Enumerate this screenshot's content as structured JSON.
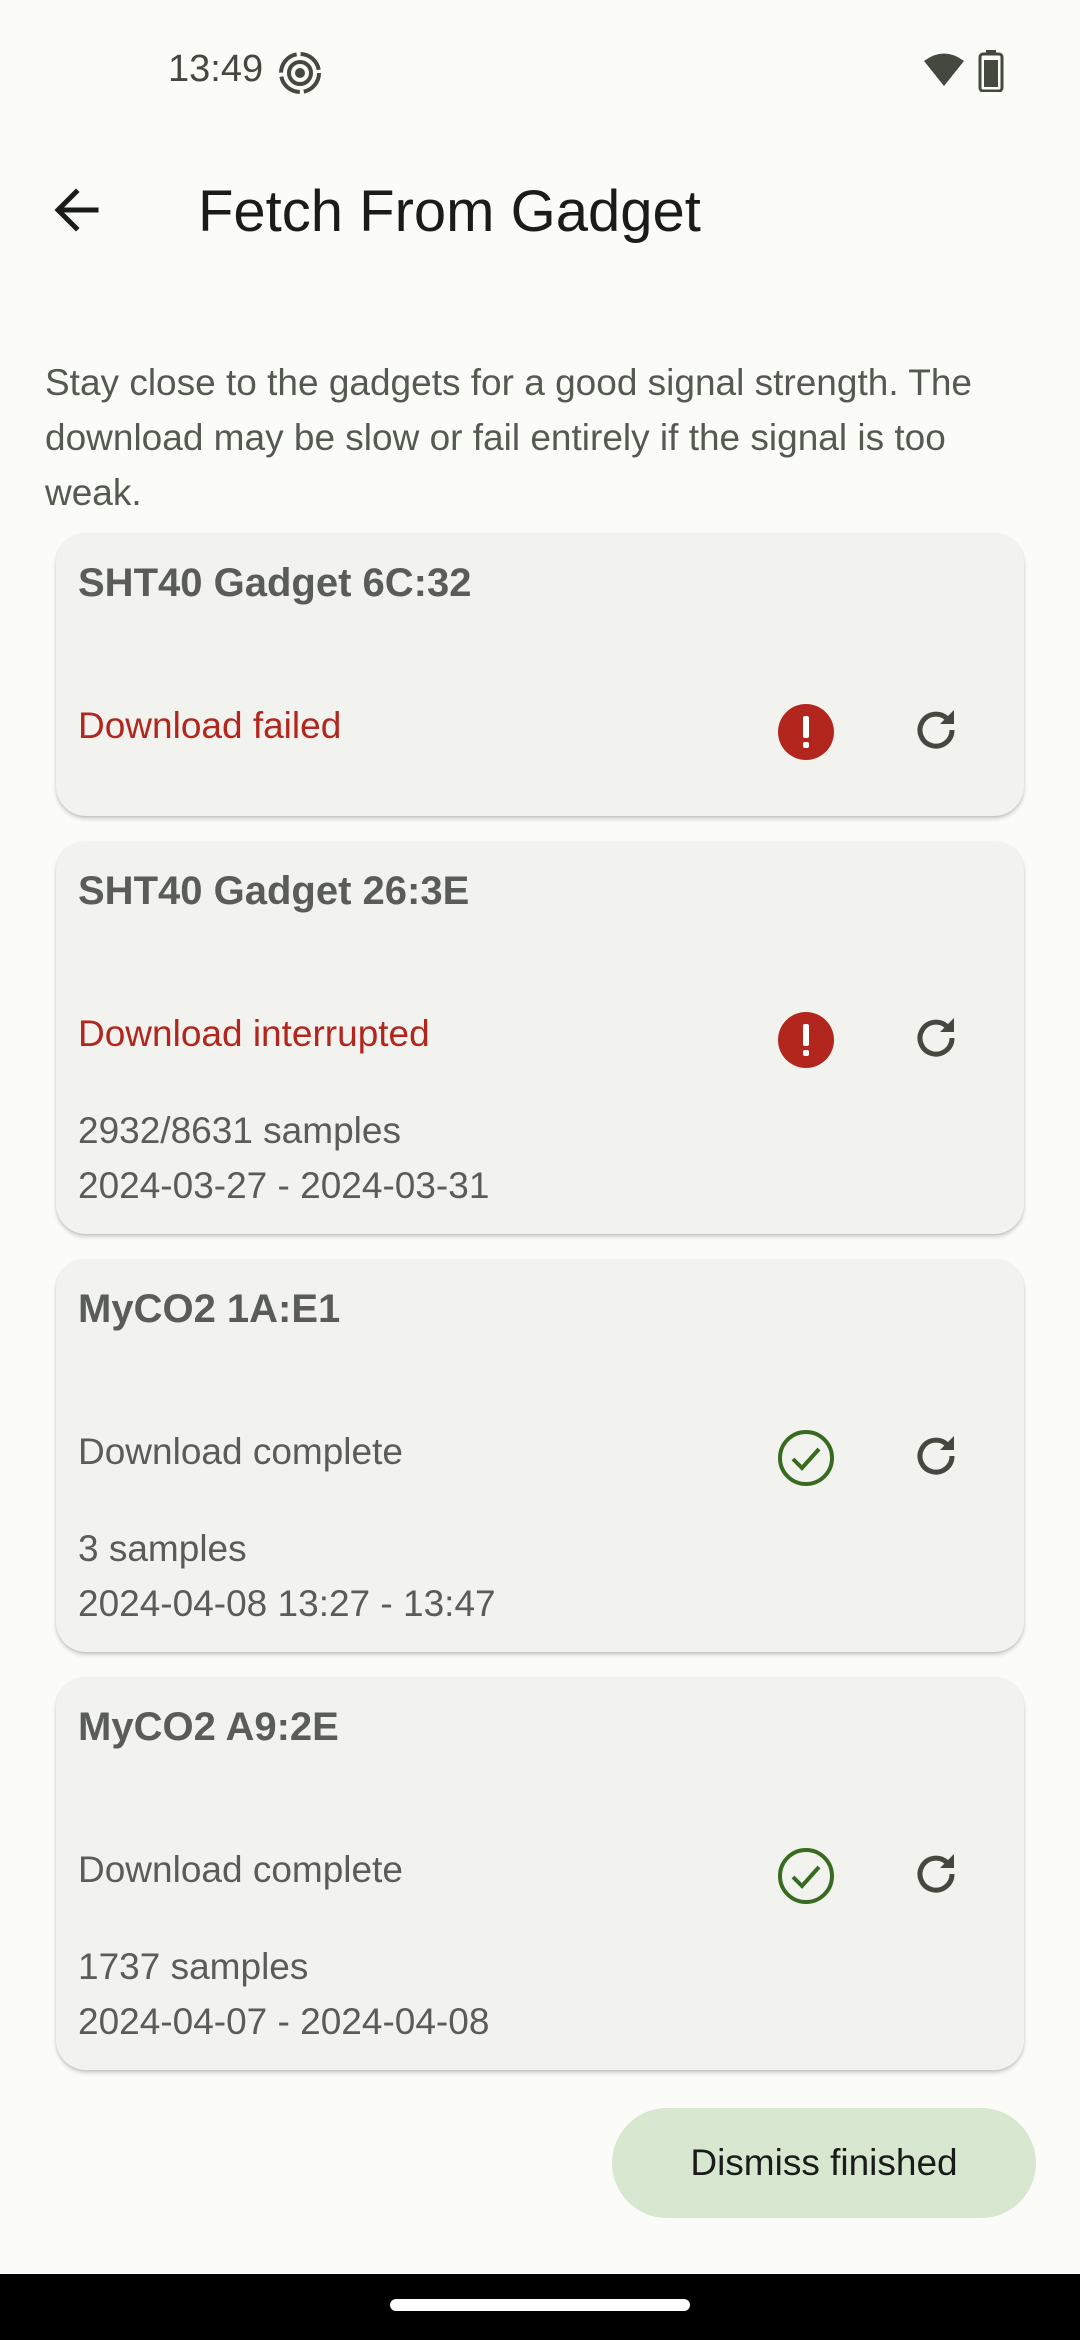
{
  "status_bar": {
    "time": "13:49",
    "icons": [
      "hotspot-icon",
      "wifi-icon",
      "battery-icon"
    ]
  },
  "app_bar": {
    "title": "Fetch From Gadget",
    "back_icon": "arrow-back-icon"
  },
  "intro_text": "Stay close to the gadgets for a good signal strength. The download may be slow or fail entirely if the signal is too weak.",
  "cards": [
    {
      "name": "SHT40 Gadget 6C:32",
      "status": "Download failed",
      "state": "error",
      "status_icon": "error-icon",
      "retry_icon": "refresh-icon"
    },
    {
      "name": "SHT40 Gadget 26:3E",
      "status": "Download interrupted",
      "state": "error",
      "status_icon": "error-icon",
      "retry_icon": "refresh-icon",
      "samples": "2932/8631 samples",
      "range": "2024-03-27 - 2024-03-31"
    },
    {
      "name": "MyCO2 1A:E1",
      "status": "Download complete",
      "state": "complete",
      "status_icon": "check-circle-icon",
      "retry_icon": "refresh-icon",
      "samples": "3 samples",
      "range": "2024-04-08 13:27 - 13:47"
    },
    {
      "name": "MyCO2 A9:2E",
      "status": "Download complete",
      "state": "complete",
      "status_icon": "check-circle-icon",
      "retry_icon": "refresh-icon",
      "samples": "1737 samples",
      "range": "2024-04-07 - 2024-04-08"
    }
  ],
  "dismiss_button": "Dismiss finished",
  "colors": {
    "error": "#b3261e",
    "success": "#386a20",
    "card_bg": "#f2f3ee",
    "button_bg": "#d8e7d0",
    "page_bg": "#fbfcf8"
  }
}
